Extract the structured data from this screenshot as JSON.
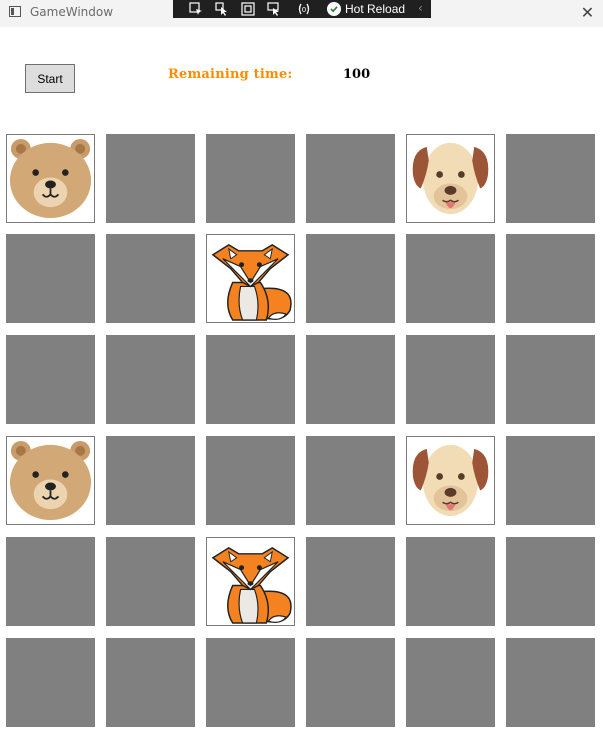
{
  "window": {
    "title": "GameWindow",
    "close_glyph": "✕"
  },
  "debug_toolbar": {
    "icons": [
      "select-element-icon",
      "pointer-icon",
      "layout-adorner-icon",
      "track-focus-icon",
      "binding-failures-icon"
    ],
    "hot_reload_label": "Hot Reload",
    "collapse_glyph": "‹"
  },
  "controls": {
    "start_label": "Start",
    "remaining_label": "Remaining time:",
    "remaining_value": "100"
  },
  "colors": {
    "accent": "#ff8c00",
    "hidden_tile": "#808080"
  },
  "board": {
    "rows": 6,
    "cols": 6,
    "tiles": [
      [
        "bear",
        "hidden",
        "hidden",
        "hidden",
        "dog",
        "hidden"
      ],
      [
        "hidden",
        "hidden",
        "fox",
        "hidden",
        "hidden",
        "hidden"
      ],
      [
        "hidden",
        "hidden",
        "hidden",
        "hidden",
        "hidden",
        "hidden"
      ],
      [
        "bear",
        "hidden",
        "hidden",
        "hidden",
        "dog",
        "hidden"
      ],
      [
        "hidden",
        "hidden",
        "fox",
        "hidden",
        "hidden",
        "hidden"
      ],
      [
        "hidden",
        "hidden",
        "hidden",
        "hidden",
        "hidden",
        "hidden"
      ]
    ]
  }
}
